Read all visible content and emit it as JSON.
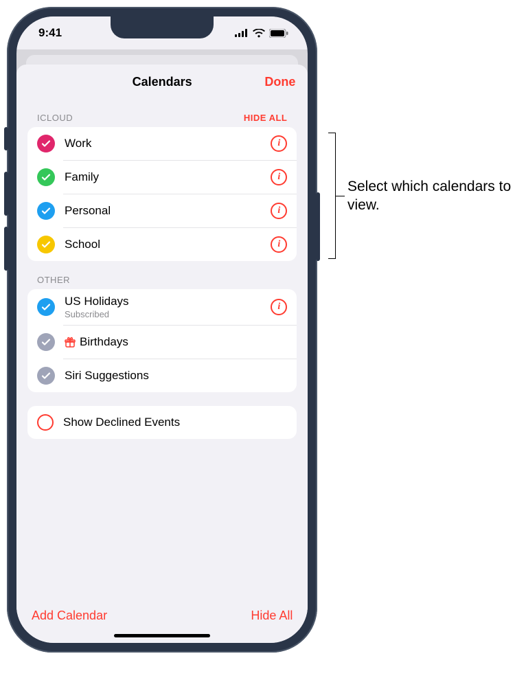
{
  "status": {
    "time": "9:41"
  },
  "sheet": {
    "title": "Calendars",
    "done_label": "Done"
  },
  "icloud": {
    "header": "ICLOUD",
    "hide_all": "HIDE ALL",
    "items": [
      {
        "label": "Work",
        "color": "#e0266b"
      },
      {
        "label": "Family",
        "color": "#34c759"
      },
      {
        "label": "Personal",
        "color": "#1e9ff0"
      },
      {
        "label": "School",
        "color": "#f7c700"
      }
    ]
  },
  "other": {
    "header": "OTHER",
    "items": [
      {
        "label": "US Holidays",
        "sub": "Subscribed",
        "color": "#1e9ff0",
        "info": true
      },
      {
        "label": "Birthdays",
        "color": "#9fa4b8",
        "gift": true
      },
      {
        "label": "Siri Suggestions",
        "color": "#9fa4b8"
      }
    ]
  },
  "declined": {
    "label": "Show Declined Events"
  },
  "bottom": {
    "add_label": "Add Calendar",
    "hide_label": "Hide All"
  },
  "callout": {
    "text": "Select which calendars to view."
  }
}
